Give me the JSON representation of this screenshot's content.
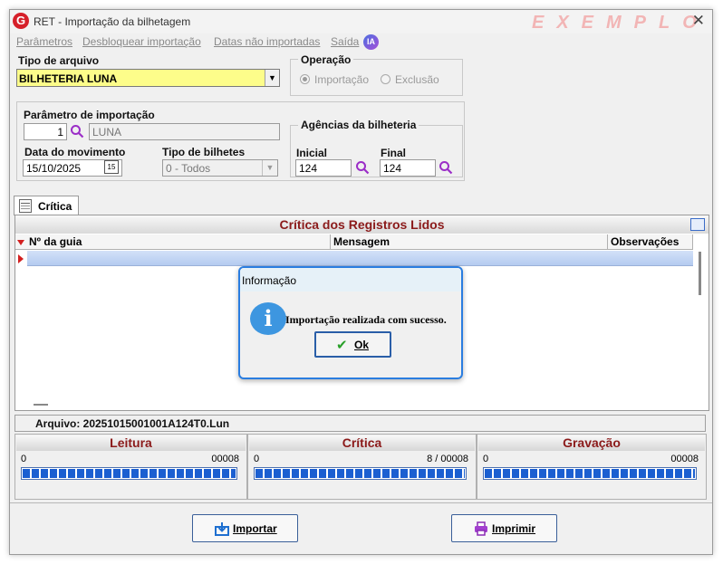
{
  "window": {
    "title": "RET - Importação da bilhetagem",
    "watermark": "EXEMPLO",
    "close_symbol": "✕"
  },
  "menu": {
    "items": [
      "Parâmetros",
      "Desbloquear importação",
      "Datas não importadas",
      "Saída"
    ],
    "ia_badge": "IA"
  },
  "tipo_arquivo": {
    "label": "Tipo de arquivo",
    "value": "BILHETERIA LUNA"
  },
  "operacao": {
    "label": "Operação",
    "options": [
      "Importação",
      "Exclusão"
    ],
    "selected": "Importação"
  },
  "parametro": {
    "label": "Parâmetro de importação",
    "code": "1",
    "name": "LUNA"
  },
  "data_movimento": {
    "label": "Data do movimento",
    "value": "15/10/2025",
    "calendar_icon": "15"
  },
  "tipo_bilhetes": {
    "label": "Tipo de bilhetes",
    "value": "0 - Todos"
  },
  "agencias": {
    "label": "Agências da bilheteria",
    "inicial_label": "Inicial",
    "inicial_value": "124",
    "final_label": "Final",
    "final_value": "124"
  },
  "tabs": [
    "Crítica"
  ],
  "grid": {
    "title": "Crítica dos Registros Lidos",
    "columns": [
      "Nº da guia",
      "Mensagem",
      "Observações"
    ]
  },
  "arquivo": {
    "text": "Arquivo: 20251015001001A124T0.Lun"
  },
  "status": [
    {
      "title": "Leitura",
      "left": "0",
      "right": "00008",
      "progress": 1.0
    },
    {
      "title": "Crítica",
      "left": "0",
      "right": "8 / 00008",
      "progress": 1.0
    },
    {
      "title": "Gravação",
      "left": "0",
      "right": "00008",
      "progress": 1.0
    }
  ],
  "buttons": {
    "importar": "Importar",
    "imprimir": "Imprimir"
  },
  "dialog": {
    "title": "Informação",
    "icon": "i",
    "message": "Importação realizada com sucesso.",
    "ok_label": "Ok",
    "check": "✔"
  },
  "colors": {
    "accent_red": "#8b1a1a",
    "selection_blue": "#b4cbf0",
    "highlight_yellow": "#fdfd8a",
    "dialog_border": "#2a7de0"
  }
}
